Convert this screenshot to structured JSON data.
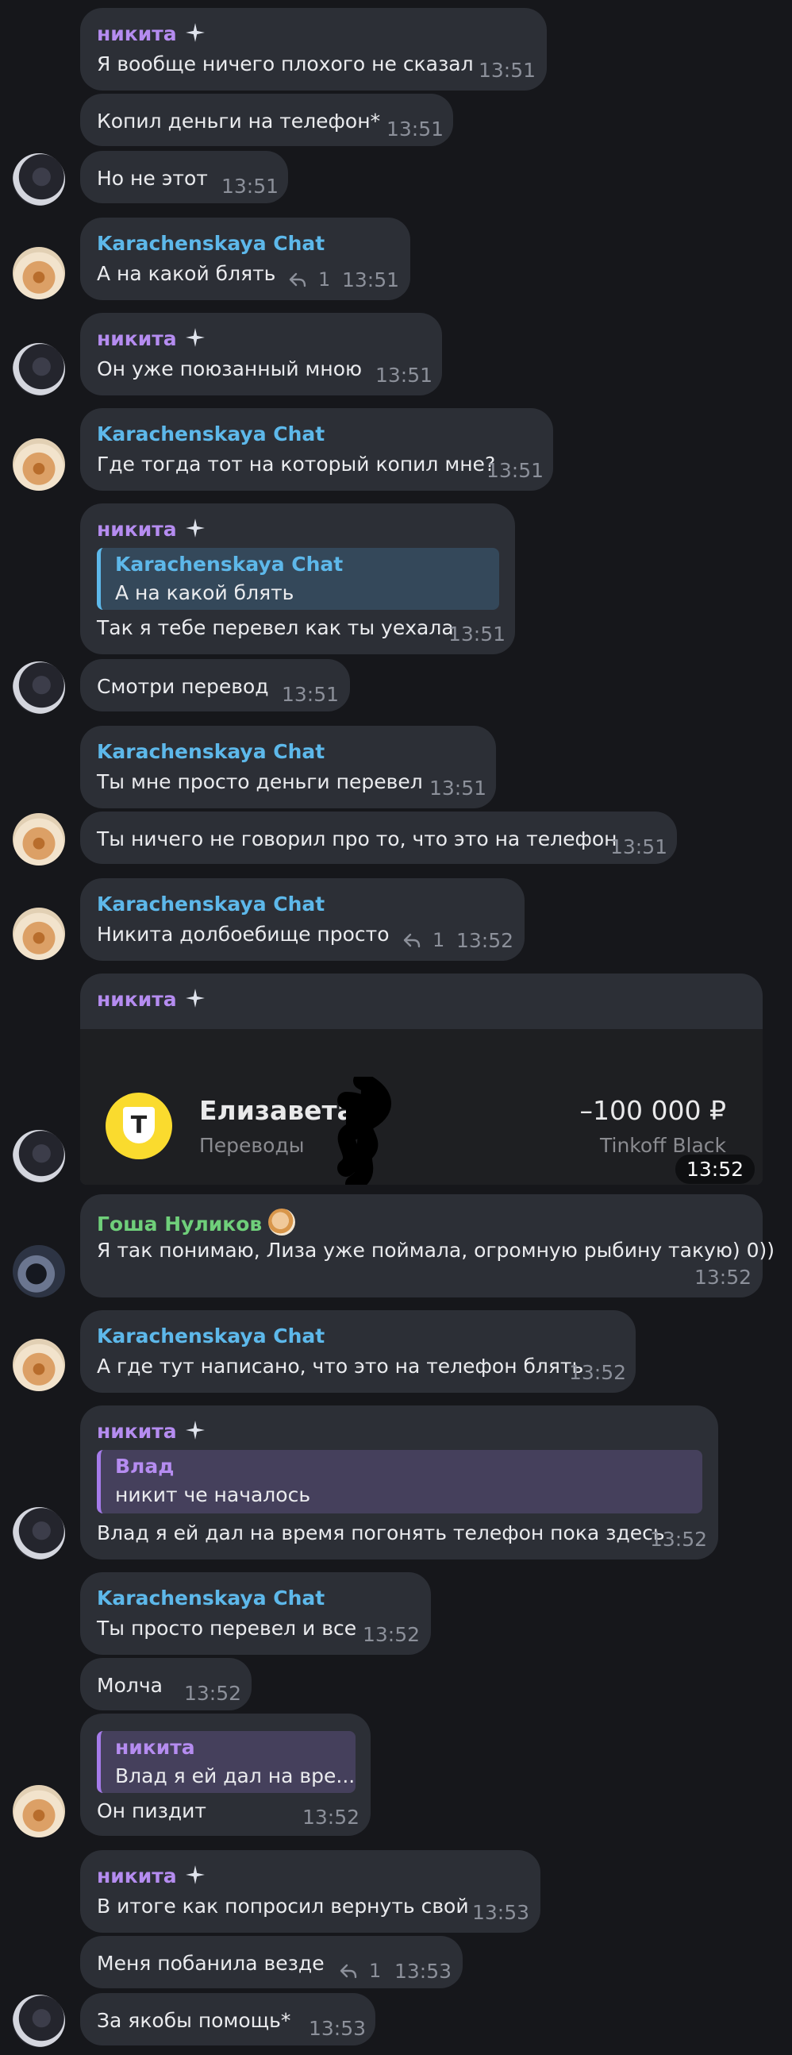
{
  "chat": {
    "messages": [
      {
        "name": "никита",
        "text": "Я вообще ничего плохого не сказал",
        "time": "13:51"
      },
      {
        "text": "Копил деньги на телефон*",
        "time": "13:51"
      },
      {
        "text": "Но не этот",
        "time": "13:51"
      },
      {
        "name": "Karachenskaya Chat",
        "text": "А на какой блять",
        "replies": "1",
        "time": "13:51"
      },
      {
        "name": "никита",
        "text": "Он уже поюзанный мною",
        "time": "13:51"
      },
      {
        "name": "Karachenskaya Chat",
        "text": "Где тогда тот на который копил мне?",
        "time": "13:51"
      },
      {
        "name": "никита",
        "quote": {
          "name": "Karachenskaya Chat",
          "text": "А на какой блять"
        },
        "text": "Так я тебе перевел как ты уехала",
        "time": "13:51"
      },
      {
        "text": "Смотри перевод",
        "time": "13:51"
      },
      {
        "name": "Karachenskaya Chat",
        "text": "Ты мне просто деньги перевел",
        "time": "13:51"
      },
      {
        "text": "Ты ничего не говорил про то, что это на телефон",
        "time": "13:51"
      },
      {
        "name": "Karachenskaya Chat",
        "text": "Никита долбоебище просто",
        "replies": "1",
        "time": "13:52"
      },
      {
        "name": "никита",
        "media": {
          "logo": "Т",
          "recipient": "Елизавета",
          "category": "Переводы",
          "amount": "–100 000 ₽",
          "card": "Tinkoff Black"
        },
        "time": "13:52"
      },
      {
        "name": "Гоша Нуликов",
        "text": "Я так понимаю, Лиза уже поймала, огромную рыбину такую) 0))",
        "time": "13:52"
      },
      {
        "name": "Karachenskaya Chat",
        "text": "А где тут написано, что это на телефон блять",
        "time": "13:52"
      },
      {
        "name": "никита",
        "quote": {
          "name": "Влад",
          "text": "никит че началось"
        },
        "text": "Влад я ей дал на время погонять телефон пока здесь",
        "time": "13:52"
      },
      {
        "name": "Karachenskaya Chat",
        "text": "Ты просто перевел и все",
        "time": "13:52"
      },
      {
        "text": "Молча",
        "time": "13:52"
      },
      {
        "quote": {
          "name": "никита",
          "text": "Влад я ей дал на вре..."
        },
        "text": "Он пиздит",
        "time": "13:52"
      },
      {
        "name": "никита",
        "text": "В итоге как попросил вернуть свой",
        "time": "13:53"
      },
      {
        "text": "Меня побанила везде",
        "replies": "1",
        "time": "13:53"
      },
      {
        "text": "За якобы помощь*",
        "time": "13:53"
      }
    ]
  },
  "colors": {
    "background": "#16171b",
    "bubble": "#2c2f36",
    "name_nikita": "#b58cf0",
    "name_karachenskaya": "#5db8ea",
    "name_gosha": "#6fcf7a",
    "timestamp": "#8c909a",
    "tinkoff_yellow": "#fadb2e"
  },
  "icons": {
    "sparkle": "sparkle-icon",
    "reply": "reply-arrow-icon",
    "emoji_status": "dog-emoji-icon"
  }
}
